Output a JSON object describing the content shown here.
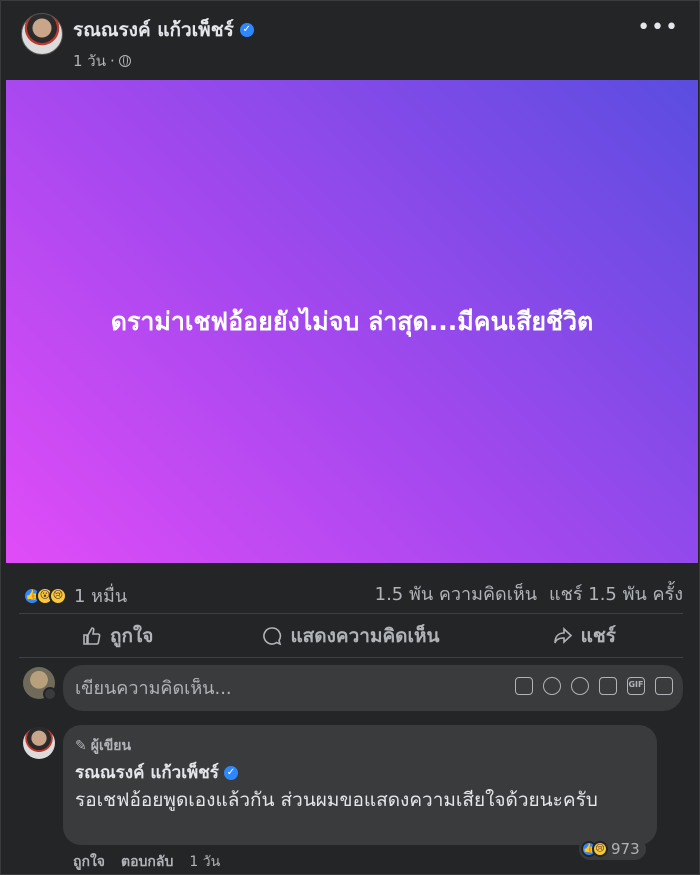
{
  "post": {
    "author": "รณณรงค์ แก้วเพ็ชร์",
    "time": "1 วัน",
    "banner_text": "ดราม่าเชฟอ้อยยังไม่จบ ล่าสุด...มีคนเสียชีวิต",
    "reaction_count": "1 หมื่น",
    "comment_count": "1.5 พัน ความคิดเห็น",
    "share_count": "แชร์ 1.5 พัน ครั้ง",
    "banner_gradient": [
      "#e04cf7",
      "#a548ef",
      "#5a4de0"
    ]
  },
  "actions": {
    "like": "ถูกใจ",
    "comment": "แสดงความคิดเห็น",
    "share": "แชร์"
  },
  "composer": {
    "placeholder": "เขียนความคิดเห็น..."
  },
  "comment": {
    "author_tag": "ผู้เขียน",
    "author": "รณณรงค์ แก้วเพ็ชร์",
    "text": "รอเชฟอ้อยพูดเองแล้วกัน ส่วนผมขอแสดงความเสียใจด้วยนะครับ",
    "reaction_count": "973",
    "like_label": "ถูกใจ",
    "reply_label": "ตอบกลับ",
    "time": "1 วัน"
  },
  "colors": {
    "background": "#242526",
    "verified": "#2d88ff"
  }
}
